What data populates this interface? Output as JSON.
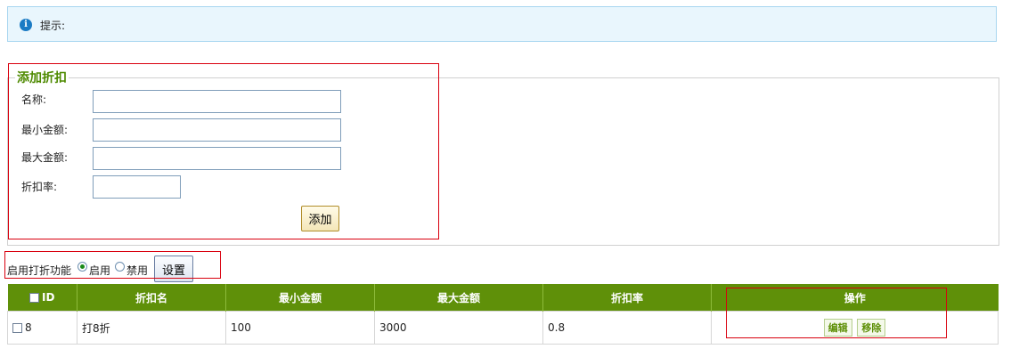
{
  "tip": {
    "icon": "info-icon",
    "text": "提示:"
  },
  "add_form": {
    "legend": "添加折扣",
    "fields": [
      {
        "label": "名称:",
        "value": ""
      },
      {
        "label": "最小金额:",
        "value": ""
      },
      {
        "label": "最大金额:",
        "value": ""
      },
      {
        "label": "折扣率:",
        "value": ""
      }
    ],
    "submit_label": "添加"
  },
  "toggle": {
    "label": "启用打折功能",
    "options": [
      {
        "label": "启用",
        "checked": true
      },
      {
        "label": "禁用",
        "checked": false
      }
    ],
    "set_label": "设置"
  },
  "table": {
    "columns": [
      "ID",
      "折扣名",
      "最小金额",
      "最大金额",
      "折扣率",
      "操作"
    ],
    "rows": [
      {
        "id": "8",
        "name": "打8折",
        "min": "100",
        "max": "3000",
        "rate": "0.8",
        "actions": [
          "编辑",
          "移除"
        ]
      }
    ]
  },
  "colors": {
    "accent": "#5f9009",
    "legend": "#4e8a00",
    "highlight_box": "#d9000e",
    "tip_bg": "#e9f6fd"
  }
}
